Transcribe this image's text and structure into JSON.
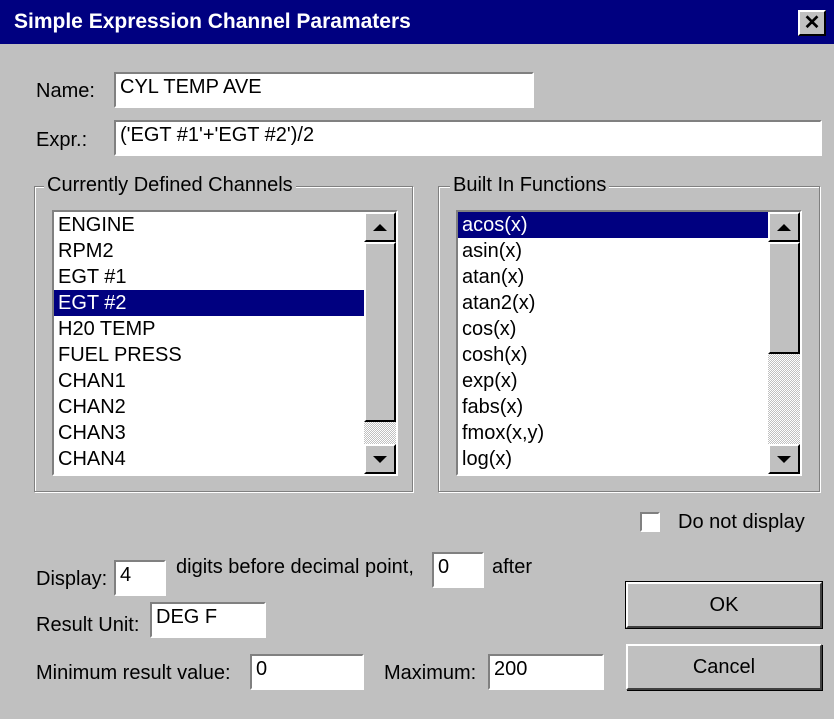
{
  "window": {
    "title": "Simple Expression Channel Paramaters",
    "close_glyph": "✕"
  },
  "form": {
    "name_label": "Name:",
    "name_value": "CYL TEMP AVE",
    "expr_label": "Expr.:",
    "expr_value": "('EGT #1'+'EGT #2')/2"
  },
  "channels": {
    "legend": "Currently Defined Channels",
    "items": [
      "ENGINE",
      "RPM2",
      "EGT #1",
      "EGT #2",
      "H20 TEMP",
      "FUEL PRESS",
      "CHAN1",
      "CHAN2",
      "CHAN3",
      "CHAN4"
    ],
    "selected": "EGT #2"
  },
  "functions": {
    "legend": "Built In Functions",
    "items": [
      "acos(x)",
      "asin(x)",
      "atan(x)",
      "atan2(x)",
      "cos(x)",
      "cosh(x)",
      "exp(x)",
      "fabs(x)",
      "fmox(x,y)",
      "log(x)"
    ],
    "selected": "acos(x)"
  },
  "do_not_display": {
    "label": "Do not display",
    "checked": false
  },
  "display": {
    "label": "Display:",
    "digits_before": "4",
    "middle_label": "digits before decimal point,",
    "digits_after": "0",
    "after_label": "after"
  },
  "result_unit": {
    "label": "Result Unit:",
    "value": "DEG F"
  },
  "range": {
    "min_label": "Minimum result value:",
    "min_value": "0",
    "max_label": "Maximum:",
    "max_value": "200"
  },
  "buttons": {
    "ok": "OK",
    "cancel": "Cancel"
  },
  "colors": {
    "face": "#c0c0c0",
    "titlebar": "#000080",
    "selection": "#000080"
  }
}
